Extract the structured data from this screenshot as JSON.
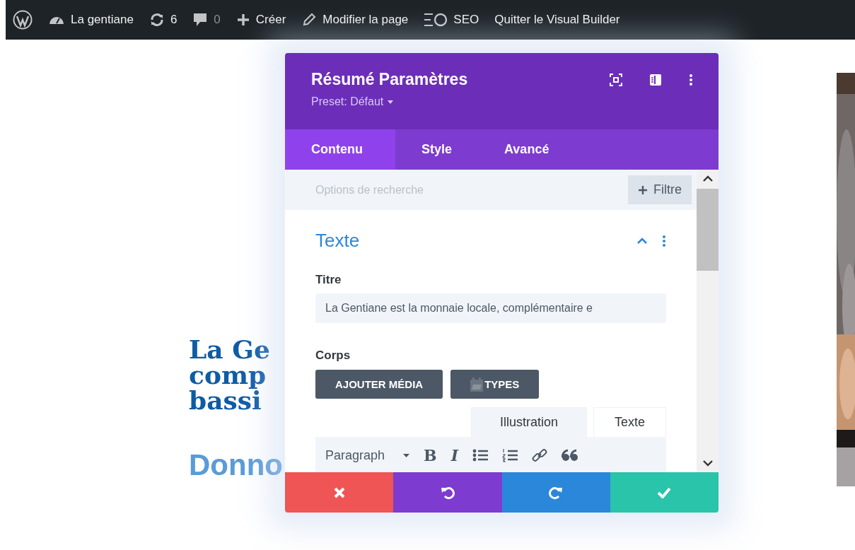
{
  "admin_bar": [
    {
      "kind": "logo"
    },
    {
      "kind": "site",
      "label": "La gentiane"
    },
    {
      "kind": "updates",
      "label": "6"
    },
    {
      "kind": "comments",
      "label": "0",
      "disabled": true
    },
    {
      "kind": "new",
      "label": "Créer"
    },
    {
      "kind": "edit",
      "label": "Modifier la page"
    },
    {
      "kind": "seo",
      "label": "SEO"
    },
    {
      "kind": "exit",
      "label": "Quitter le Visual Builder"
    }
  ],
  "page": {
    "heading_lines": [
      "La Ge",
      "comp",
      "bassi"
    ],
    "subheading": "Donno",
    "photo": {
      "kind": "picture"
    }
  },
  "modal": {
    "title": "Résumé Paramètres",
    "preset": "Preset: Défaut",
    "tabs": [
      {
        "label": "Contenu",
        "selected": true
      },
      {
        "label": "Style",
        "selected": false
      },
      {
        "label": "Avancé",
        "selected": false
      }
    ],
    "search": {
      "placeholder": "Options de recherche"
    },
    "filter_button": "Filtre",
    "section": {
      "title": "Texte",
      "expanded": true
    },
    "title_field": {
      "label": "Titre",
      "value": "La Gentiane est la monnaie locale, complémentaire e"
    },
    "body_label": "Corps",
    "media_buttons": [
      {
        "kind": "media",
        "label": "AJOUTER MÉDIA"
      },
      {
        "kind": "types",
        "label": "TYPES"
      }
    ],
    "editor_tabs": [
      {
        "label": "Illustration",
        "selected": true
      },
      {
        "label": "Texte",
        "selected": false
      }
    ],
    "toolbar": {
      "format": "Paragraph",
      "buttons": [
        {
          "kind": "bold",
          "label": "B"
        },
        {
          "kind": "italic",
          "label": "I"
        },
        {
          "kind": "bullets"
        },
        {
          "kind": "numbers"
        },
        {
          "kind": "link"
        },
        {
          "kind": "quote"
        }
      ]
    },
    "footer_buttons": [
      {
        "kind": "cancel"
      },
      {
        "kind": "undo"
      },
      {
        "kind": "redo"
      },
      {
        "kind": "save"
      }
    ]
  }
}
